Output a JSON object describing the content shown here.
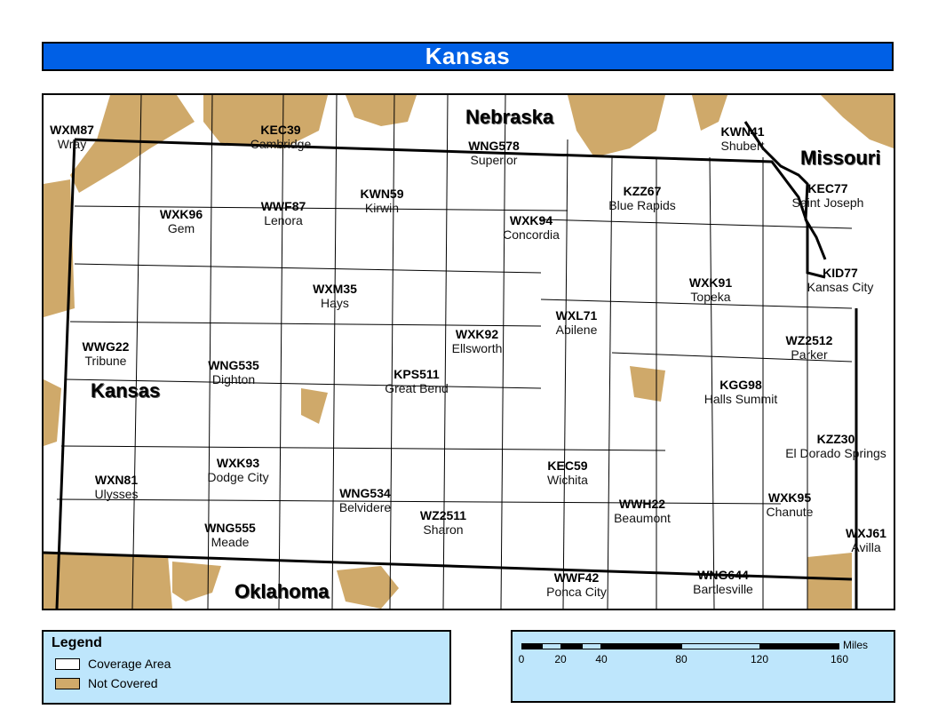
{
  "title": "Kansas",
  "colors": {
    "title_bg": "#0060e6",
    "coverage": "#ffffff",
    "not_covered": "#cfa96a",
    "panel_bg": "#bee6fc"
  },
  "map": {
    "states": [
      {
        "id": "nebraska",
        "label": "Nebraska"
      },
      {
        "id": "missouri",
        "label": "Missouri"
      },
      {
        "id": "kansas",
        "label": "Kansas"
      },
      {
        "id": "oklahoma",
        "label": "Oklahoma"
      }
    ],
    "stations": [
      {
        "call": "WXM87",
        "city": "Wray"
      },
      {
        "call": "KEC39",
        "city": "Cambridge"
      },
      {
        "call": "WNG578",
        "city": "Superior"
      },
      {
        "call": "KWN41",
        "city": "Shubert"
      },
      {
        "call": "KZZ67",
        "city": "Blue Rapids"
      },
      {
        "call": "KEC77",
        "city": "Saint Joseph"
      },
      {
        "call": "WXK96",
        "city": "Gem"
      },
      {
        "call": "WWF87",
        "city": "Lenora"
      },
      {
        "call": "KWN59",
        "city": "Kirwin"
      },
      {
        "call": "WXK94",
        "city": "Concordia"
      },
      {
        "call": "WXM35",
        "city": "Hays"
      },
      {
        "call": "WXK91",
        "city": "Topeka"
      },
      {
        "call": "KID77",
        "city": "Kansas City"
      },
      {
        "call": "WWG22",
        "city": "Tribune"
      },
      {
        "call": "WXK92",
        "city": "Ellsworth"
      },
      {
        "call": "WXL71",
        "city": "Abilene"
      },
      {
        "call": "WZ2512",
        "city": "Parker"
      },
      {
        "call": "WNG535",
        "city": "Dighton"
      },
      {
        "call": "KPS511",
        "city": "Great Bend"
      },
      {
        "call": "KGG98",
        "city": "Halls Summit"
      },
      {
        "call": "KZZ30",
        "city": "El Dorado Springs"
      },
      {
        "call": "WXN81",
        "city": "Ulysses"
      },
      {
        "call": "WXK93",
        "city": "Dodge City"
      },
      {
        "call": "KEC59",
        "city": "Wichita"
      },
      {
        "call": "WNG534",
        "city": "Belvidere"
      },
      {
        "call": "WXK95",
        "city": "Chanute"
      },
      {
        "call": "WZ2511",
        "city": "Sharon"
      },
      {
        "call": "WWH22",
        "city": "Beaumont"
      },
      {
        "call": "WNG555",
        "city": "Meade"
      },
      {
        "call": "WXJ61",
        "city": "Avilla"
      },
      {
        "call": "WWF42",
        "city": "Ponca City"
      },
      {
        "call": "WNG644",
        "city": "Bartlesville"
      }
    ]
  },
  "legend": {
    "title": "Legend",
    "items": [
      {
        "label": "Coverage Area"
      },
      {
        "label": "Not Covered"
      }
    ]
  },
  "scale_bar": {
    "unit": "Miles",
    "ticks": [
      "0",
      "20",
      "40",
      "80",
      "120",
      "160"
    ]
  }
}
